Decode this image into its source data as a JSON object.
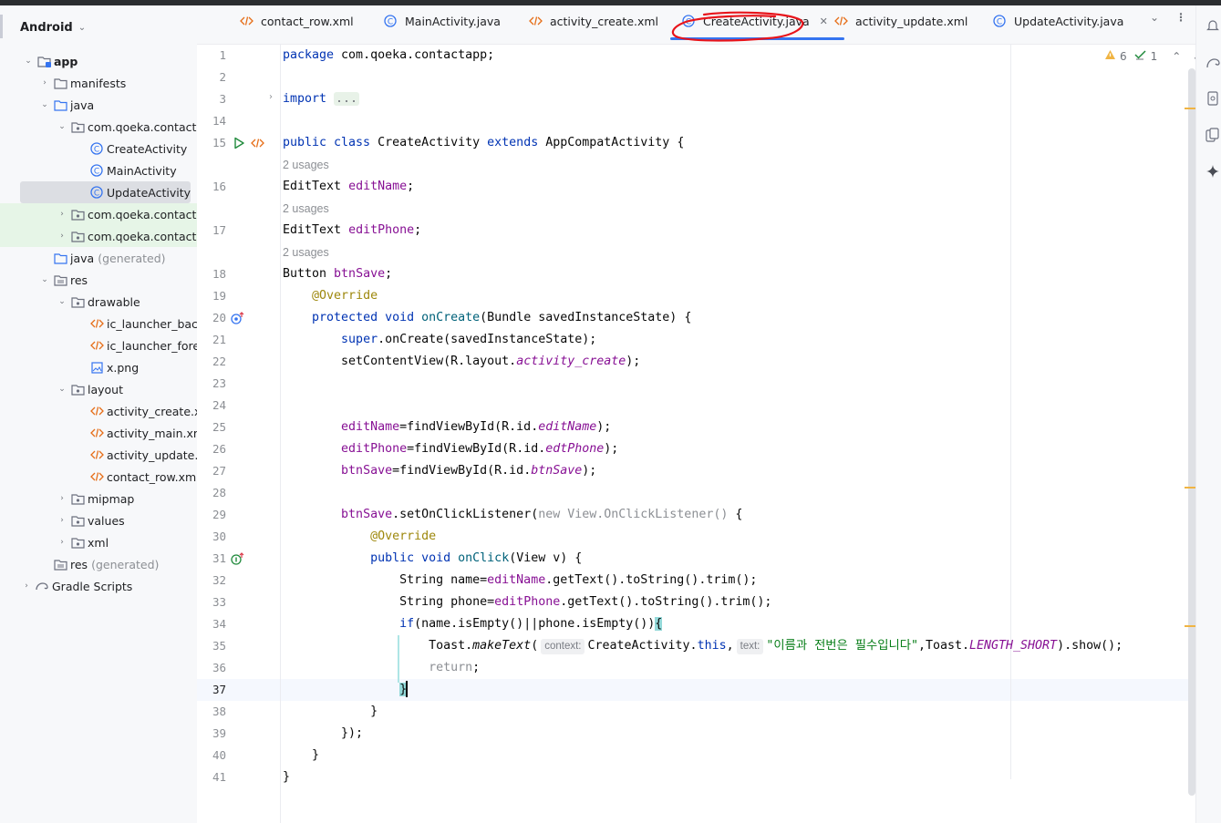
{
  "project": {
    "view_label": "Android",
    "tree": [
      {
        "label": "app",
        "bold": true
      },
      {
        "label": "manifests"
      },
      {
        "label": "java"
      },
      {
        "label": "com.qoeka.contacta"
      },
      {
        "label": "CreateActivity"
      },
      {
        "label": "MainActivity"
      },
      {
        "label": "UpdateActivity"
      },
      {
        "label": "com.qoeka.contacta"
      },
      {
        "label": "com.qoeka.contacta"
      },
      {
        "label": "java",
        "suffix": "(generated)"
      },
      {
        "label": "res"
      },
      {
        "label": "drawable"
      },
      {
        "label": "ic_launcher_bacl"
      },
      {
        "label": "ic_launcher_fore"
      },
      {
        "label": "x.png"
      },
      {
        "label": "layout"
      },
      {
        "label": "activity_create.xn"
      },
      {
        "label": "activity_main.xml"
      },
      {
        "label": "activity_update.x"
      },
      {
        "label": "contact_row.xml"
      },
      {
        "label": "mipmap"
      },
      {
        "label": "values"
      },
      {
        "label": "xml"
      },
      {
        "label": "res",
        "suffix": "(generated)"
      },
      {
        "label": "Gradle Scripts"
      }
    ]
  },
  "tabs": [
    {
      "label": "contact_row.xml",
      "icon": "xml-file-icon"
    },
    {
      "label": "MainActivity.java",
      "icon": "java-class-icon"
    },
    {
      "label": "activity_create.xml",
      "icon": "xml-file-icon"
    },
    {
      "label": "CreateActivity.java",
      "icon": "java-class-icon",
      "active": true
    },
    {
      "label": "activity_update.xml",
      "icon": "xml-file-icon"
    },
    {
      "label": "UpdateActivity.java",
      "icon": "java-class-icon"
    }
  ],
  "inspections": {
    "warnings": "6",
    "weak_warnings": "1"
  },
  "editor": {
    "line_numbers": [
      "1",
      "2",
      "3",
      "14",
      "15",
      "16",
      "17",
      "18",
      "19",
      "20",
      "21",
      "22",
      "23",
      "24",
      "25",
      "26",
      "27",
      "28",
      "29",
      "30",
      "31",
      "32",
      "33",
      "34",
      "35",
      "36",
      "37",
      "38",
      "39",
      "40",
      "41"
    ],
    "usage_hint": "2 usages",
    "hint_context": "context:",
    "hint_text": "text:",
    "toast_message": "\"이름과 전번은 필수입니다\"",
    "package_name": "com.qoeka.contactapp;",
    "class_name": "CreateActivity"
  },
  "colors": {
    "keyword": "#0033b3",
    "field": "#871094",
    "annotation": "#9e880d",
    "string": "#067d17",
    "accent": "#3574f0",
    "annotation_circle": "#e8141b"
  }
}
